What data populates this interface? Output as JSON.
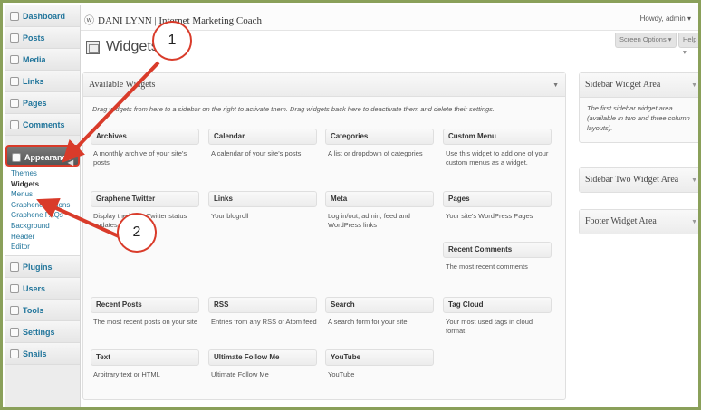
{
  "topbar": {
    "site_title": "DANI LYNN | Internet Marketing Coach",
    "howdy": "Howdy, admin",
    "screen_options": "Screen Options",
    "help": "Help"
  },
  "sidebar": {
    "items": [
      {
        "label": "Dashboard",
        "icon": "dashboard-icon"
      },
      {
        "label": "Posts",
        "icon": "pin-icon"
      },
      {
        "label": "Media",
        "icon": "media-icon"
      },
      {
        "label": "Links",
        "icon": "link-icon"
      },
      {
        "label": "Pages",
        "icon": "page-icon"
      },
      {
        "label": "Comments",
        "icon": "comment-icon"
      },
      {
        "label": "Appearance",
        "icon": "appearance-icon"
      }
    ],
    "appearance_sub": [
      "Themes",
      "Widgets",
      "Menus",
      "Graphene Options",
      "Graphene FAQs",
      "Background",
      "Header",
      "Editor"
    ],
    "items_after": [
      {
        "label": "Plugins",
        "icon": "plugin-icon"
      },
      {
        "label": "Users",
        "icon": "users-icon"
      },
      {
        "label": "Tools",
        "icon": "tools-icon"
      },
      {
        "label": "Settings",
        "icon": "settings-icon"
      }
    ],
    "cut_off_label": "Snails"
  },
  "page": {
    "title": "Widgets"
  },
  "available": {
    "title": "Available Widgets",
    "description": "Drag widgets from here to a sidebar on the right to activate them. Drag widgets back here to deactivate them and delete their settings.",
    "widgets": [
      {
        "title": "Archives",
        "desc": "A monthly archive of your site's posts"
      },
      {
        "title": "Calendar",
        "desc": "A calendar of your site's posts"
      },
      {
        "title": "Categories",
        "desc": "A list or dropdown of categories"
      },
      {
        "title": "Custom Menu",
        "desc": "Use this widget to add one of your custom menus as a widget."
      },
      {
        "title": "Graphene Twitter",
        "desc": "Display the latest Twitter status updates."
      },
      {
        "title": "Links",
        "desc": "Your blogroll"
      },
      {
        "title": "Meta",
        "desc": "Log in/out, admin, feed and WordPress links"
      },
      {
        "title": "Pages",
        "desc": "Your site's WordPress Pages"
      },
      {
        "title": "Recent Comments",
        "desc": "The most recent comments"
      },
      {
        "title": "Recent Posts",
        "desc": "The most recent posts on your site"
      },
      {
        "title": "RSS",
        "desc": "Entries from any RSS or Atom feed"
      },
      {
        "title": "Search",
        "desc": "A search form for your site"
      },
      {
        "title": "Tag Cloud",
        "desc": "Your most used tags in cloud format"
      },
      {
        "title": "Text",
        "desc": "Arbitrary text or HTML"
      },
      {
        "title": "Ultimate Follow Me",
        "desc": "Ultimate Follow Me"
      },
      {
        "title": "YouTube",
        "desc": "YouTube"
      }
    ]
  },
  "areas": [
    {
      "title": "Sidebar Widget Area",
      "desc": "The first sidebar widget area (available in two and three column layouts)."
    },
    {
      "title": "Sidebar Two Widget Area",
      "desc": ""
    },
    {
      "title": "Footer Widget Area",
      "desc": ""
    }
  ],
  "annotations": {
    "badge1": "1",
    "badge2": "2",
    "color": "#d93b2a"
  }
}
